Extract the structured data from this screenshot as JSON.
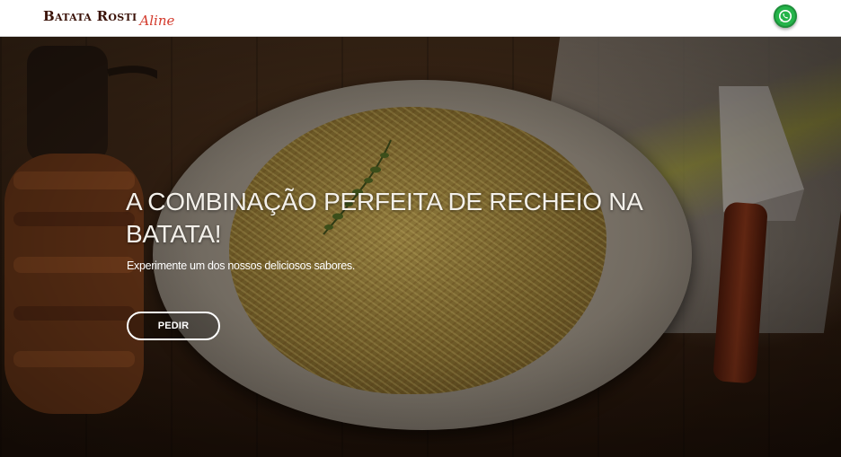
{
  "header": {
    "brand_main": "Batata Rosti",
    "brand_script": "Aline",
    "whatsapp_icon": "whatsapp-icon",
    "whatsapp_color": "#25b44a"
  },
  "hero": {
    "headline": "A COMBINAÇÃO PERFEITA DE RECHEIO NA BATATA!",
    "subtitle": "Experimente um dos nossos deliciosos sabores.",
    "button_label": "PEDIR",
    "background_image": "photo of batata rösti on a white plate with pepper grinder, napkin and spatula on a wooden table"
  }
}
